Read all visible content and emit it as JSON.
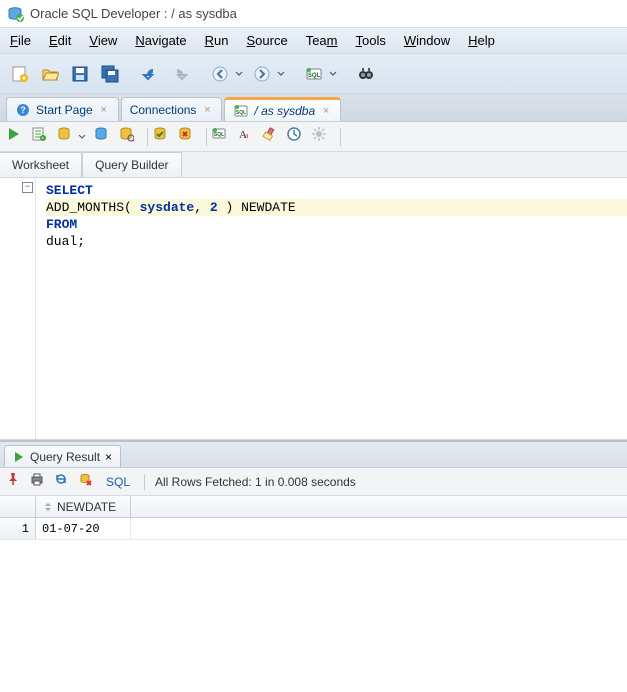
{
  "window": {
    "title": "Oracle SQL Developer : / as sysdba"
  },
  "menu": [
    {
      "label": "File",
      "u": "F"
    },
    {
      "label": "Edit",
      "u": "E"
    },
    {
      "label": "View",
      "u": "V"
    },
    {
      "label": "Navigate",
      "u": "N"
    },
    {
      "label": "Run",
      "u": "R"
    },
    {
      "label": "Source",
      "u": "S"
    },
    {
      "label": "Team",
      "u": "m",
      "pre": "Tea"
    },
    {
      "label": "Tools",
      "u": "T"
    },
    {
      "label": "Window",
      "u": "W"
    },
    {
      "label": "Help",
      "u": "H"
    }
  ],
  "tabs": [
    {
      "label": "Start Page",
      "icon": "help-icon",
      "active": false
    },
    {
      "label": "Connections",
      "icon": null,
      "active": false
    },
    {
      "label": "/ as sysdba",
      "icon": "sql-file-icon",
      "active": true,
      "italic": true
    }
  ],
  "subtabs": [
    "Worksheet",
    "Query Builder"
  ],
  "editor": {
    "line1_kw": "SELECT",
    "line2_indent": "  ",
    "line2_func": "ADD_MONTHS",
    "line2_open": "( ",
    "line2_arg1": "sysdate",
    "line2_comma": ", ",
    "line2_arg2": "2",
    "line2_close": " ) ",
    "line2_alias": "NEWDATE",
    "line3_kw": "FROM",
    "line4_indent": "  ",
    "line4_tbl": "dual;"
  },
  "results": {
    "tab_label": "Query Result",
    "sql_label": "SQL",
    "status": "All Rows Fetched: 1 in 0.008 seconds",
    "columns": [
      "NEWDATE"
    ],
    "rows": [
      {
        "n": "1",
        "cells": [
          "01-07-20"
        ]
      }
    ]
  }
}
